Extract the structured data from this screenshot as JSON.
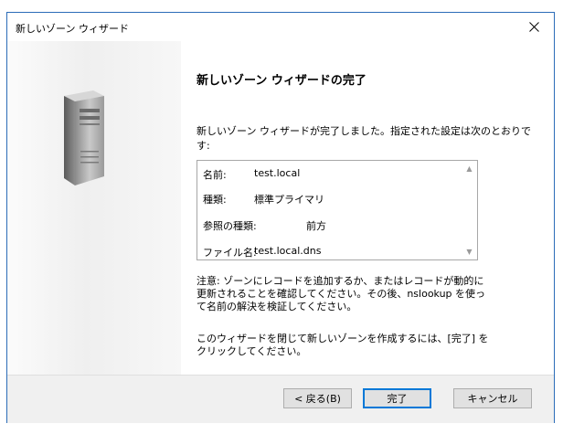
{
  "window": {
    "title": "新しいゾーン ウィザード",
    "close_label": "✕"
  },
  "content": {
    "heading": "新しいゾーン ウィザードの完了",
    "intro": "新しいゾーン ウィザードが完了しました。指定された設定は次のとおりです:",
    "summary": [
      {
        "key": "名前:",
        "value": "test.local"
      },
      {
        "key": "種類:",
        "value": "標準プライマリ"
      },
      {
        "key": "参照の種類:",
        "value": "前方"
      },
      {
        "key": "ファイル名:",
        "value": "test.local.dns"
      }
    ],
    "note": "注意: ゾーンにレコードを追加するか、またはレコードが動的に更新されることを確認してください。その後、nslookup を使って名前の解決を検証してください。",
    "closing": "このウィザードを閉じて新しいゾーンを作成するには、[完了] をクリックしてください。"
  },
  "buttons": {
    "back": "< 戻る(B)",
    "finish": "完了",
    "cancel": "キャンセル"
  },
  "icons": {
    "sidebar": "server-icon",
    "close": "close-icon"
  }
}
